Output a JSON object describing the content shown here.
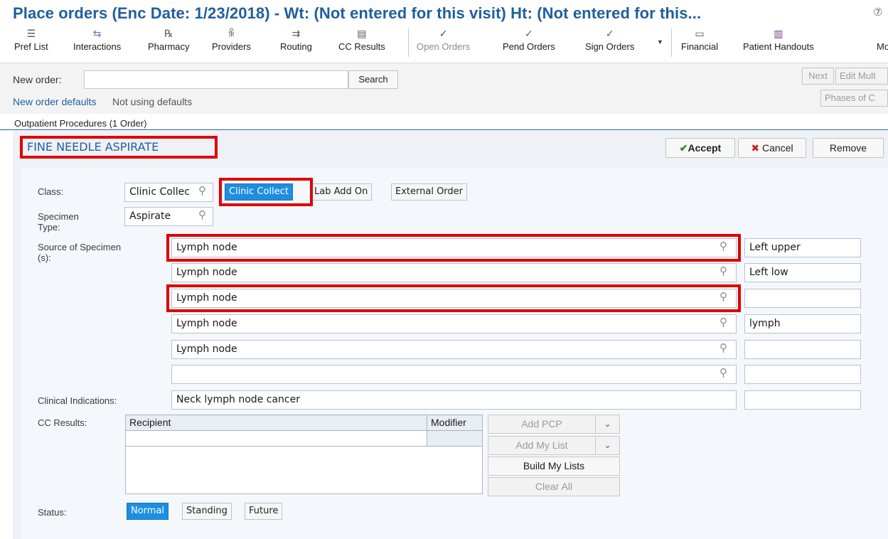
{
  "window": {
    "title": "Place orders (Enc Date: 1/23/2018) - Wt: (Not entered for this visit) Ht: (Not entered for this..."
  },
  "toolbar": {
    "items": [
      {
        "label": "Pref List",
        "icon": "list-icon"
      },
      {
        "label": "Interactions",
        "icon": "interactions-icon"
      },
      {
        "label": "Pharmacy",
        "icon": "rx-icon"
      },
      {
        "label": "Providers",
        "icon": "providers-icon"
      },
      {
        "label": "Routing",
        "icon": "routing-icon"
      },
      {
        "label": "CC Results",
        "icon": "document-icon"
      },
      {
        "label": "Open Orders",
        "icon": "open-orders-icon"
      },
      {
        "label": "Pend Orders",
        "icon": "pend-orders-icon"
      },
      {
        "label": "Sign Orders",
        "icon": "checkmark-icon"
      },
      {
        "label": "Financial",
        "icon": "money-icon"
      },
      {
        "label": "Patient Handouts",
        "icon": "handouts-icon"
      },
      {
        "label": "Mo",
        "icon": ""
      }
    ]
  },
  "new_order": {
    "label": "New order:",
    "value": "",
    "search_label": "Search",
    "next_label": "Next",
    "edit_multiple_label": "Edit Mult",
    "phases_label": "Phases of C",
    "defaults_link": "New order defaults",
    "defaults_status": "Not using defaults"
  },
  "section": {
    "header": "Outpatient Procedures (1 Order)",
    "order_name": "FINE NEEDLE ASPIRATE",
    "accept_label": "Accept",
    "cancel_label": "Cancel",
    "remove_label": "Remove"
  },
  "form": {
    "class_label": "Class:",
    "class_value": "Clinic Collec",
    "class_options": [
      "Clinic Collect",
      "Lab Add On",
      "External Order"
    ],
    "class_selected": "Clinic Collect",
    "specimen_type_label_1": "Specimen",
    "specimen_type_label_2": "Type:",
    "specimen_type_value": "Aspirate",
    "source_label_1": "Source of Specimen",
    "source_label_2": "(s):",
    "sources": [
      {
        "value": "Lymph node",
        "comment": "Left upper"
      },
      {
        "value": "Lymph node",
        "comment": "Left low"
      },
      {
        "value": "Lymph node",
        "comment": ""
      },
      {
        "value": "Lymph node",
        "comment": "lymph"
      },
      {
        "value": "Lymph node",
        "comment": ""
      },
      {
        "value": "",
        "comment": ""
      }
    ],
    "clinical_indications_label": "Clinical Indications:",
    "clinical_indications_value": "Neck lymph node cancer",
    "clinical_indications_comment": "",
    "cc_results_label": "CC Results:",
    "cc_headers": [
      "Recipient",
      "Modifier"
    ],
    "cc_buttons": {
      "add_pcp": "Add PCP",
      "add_my_list": "Add My List",
      "build_my_lists": "Build My Lists",
      "clear_all": "Clear All"
    },
    "status_label": "Status:",
    "status_options": [
      "Normal",
      "Standing",
      "Future"
    ],
    "status_selected": "Normal"
  }
}
